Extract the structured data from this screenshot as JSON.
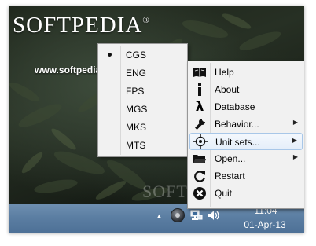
{
  "desktop": {
    "brand": "SOFTPEDIA",
    "brand_mark": "®",
    "url": "www.softpedia.com",
    "watermark": "SOFTPEDIA"
  },
  "unit_sets_submenu": {
    "selected": "CGS",
    "items": [
      {
        "label": "CGS"
      },
      {
        "label": "ENG"
      },
      {
        "label": "FPS"
      },
      {
        "label": "MGS"
      },
      {
        "label": "MKS"
      },
      {
        "label": "MTS"
      }
    ]
  },
  "context_menu": {
    "highlighted": "Unit sets...",
    "items": [
      {
        "label": "Help",
        "icon": "book-icon"
      },
      {
        "label": "About",
        "icon": "info-icon"
      },
      {
        "label": "Database",
        "icon": "lambda-icon"
      },
      {
        "label": "Behavior...",
        "icon": "wrench-icon",
        "has_submenu": true
      },
      {
        "label": "Unit sets...",
        "icon": "crosshair-icon",
        "has_submenu": true
      },
      {
        "label": "Open...",
        "icon": "folder-icon",
        "has_submenu": true
      },
      {
        "label": "Restart",
        "icon": "restart-icon"
      },
      {
        "label": "Quit",
        "icon": "quit-icon"
      }
    ]
  },
  "taskbar": {
    "time": "11:04",
    "date": "01-Apr-13"
  }
}
